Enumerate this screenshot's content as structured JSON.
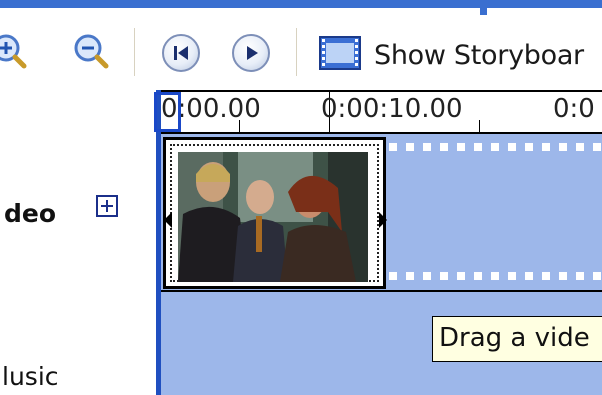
{
  "toolbar": {
    "zoom_in_icon": "zoom-in-icon",
    "zoom_out_icon": "zoom-out-icon",
    "rewind_icon": "rewind-icon",
    "play_icon": "play-icon",
    "storyboard_icon": "film-strip-icon",
    "storyboard_label": "Show Storyboar"
  },
  "timeline": {
    "ruler_labels": [
      "0:00.00",
      "0:00:10.00",
      "0:0"
    ]
  },
  "tracks": {
    "video_label": "deo",
    "music_label": "lusic"
  },
  "tooltip": {
    "text": "Drag a vide"
  },
  "colors": {
    "accent": "#3a6fd0",
    "track_blue": "#9db7ea",
    "playhead": "#1a48c8",
    "tooltip_bg": "#ffffe1"
  }
}
